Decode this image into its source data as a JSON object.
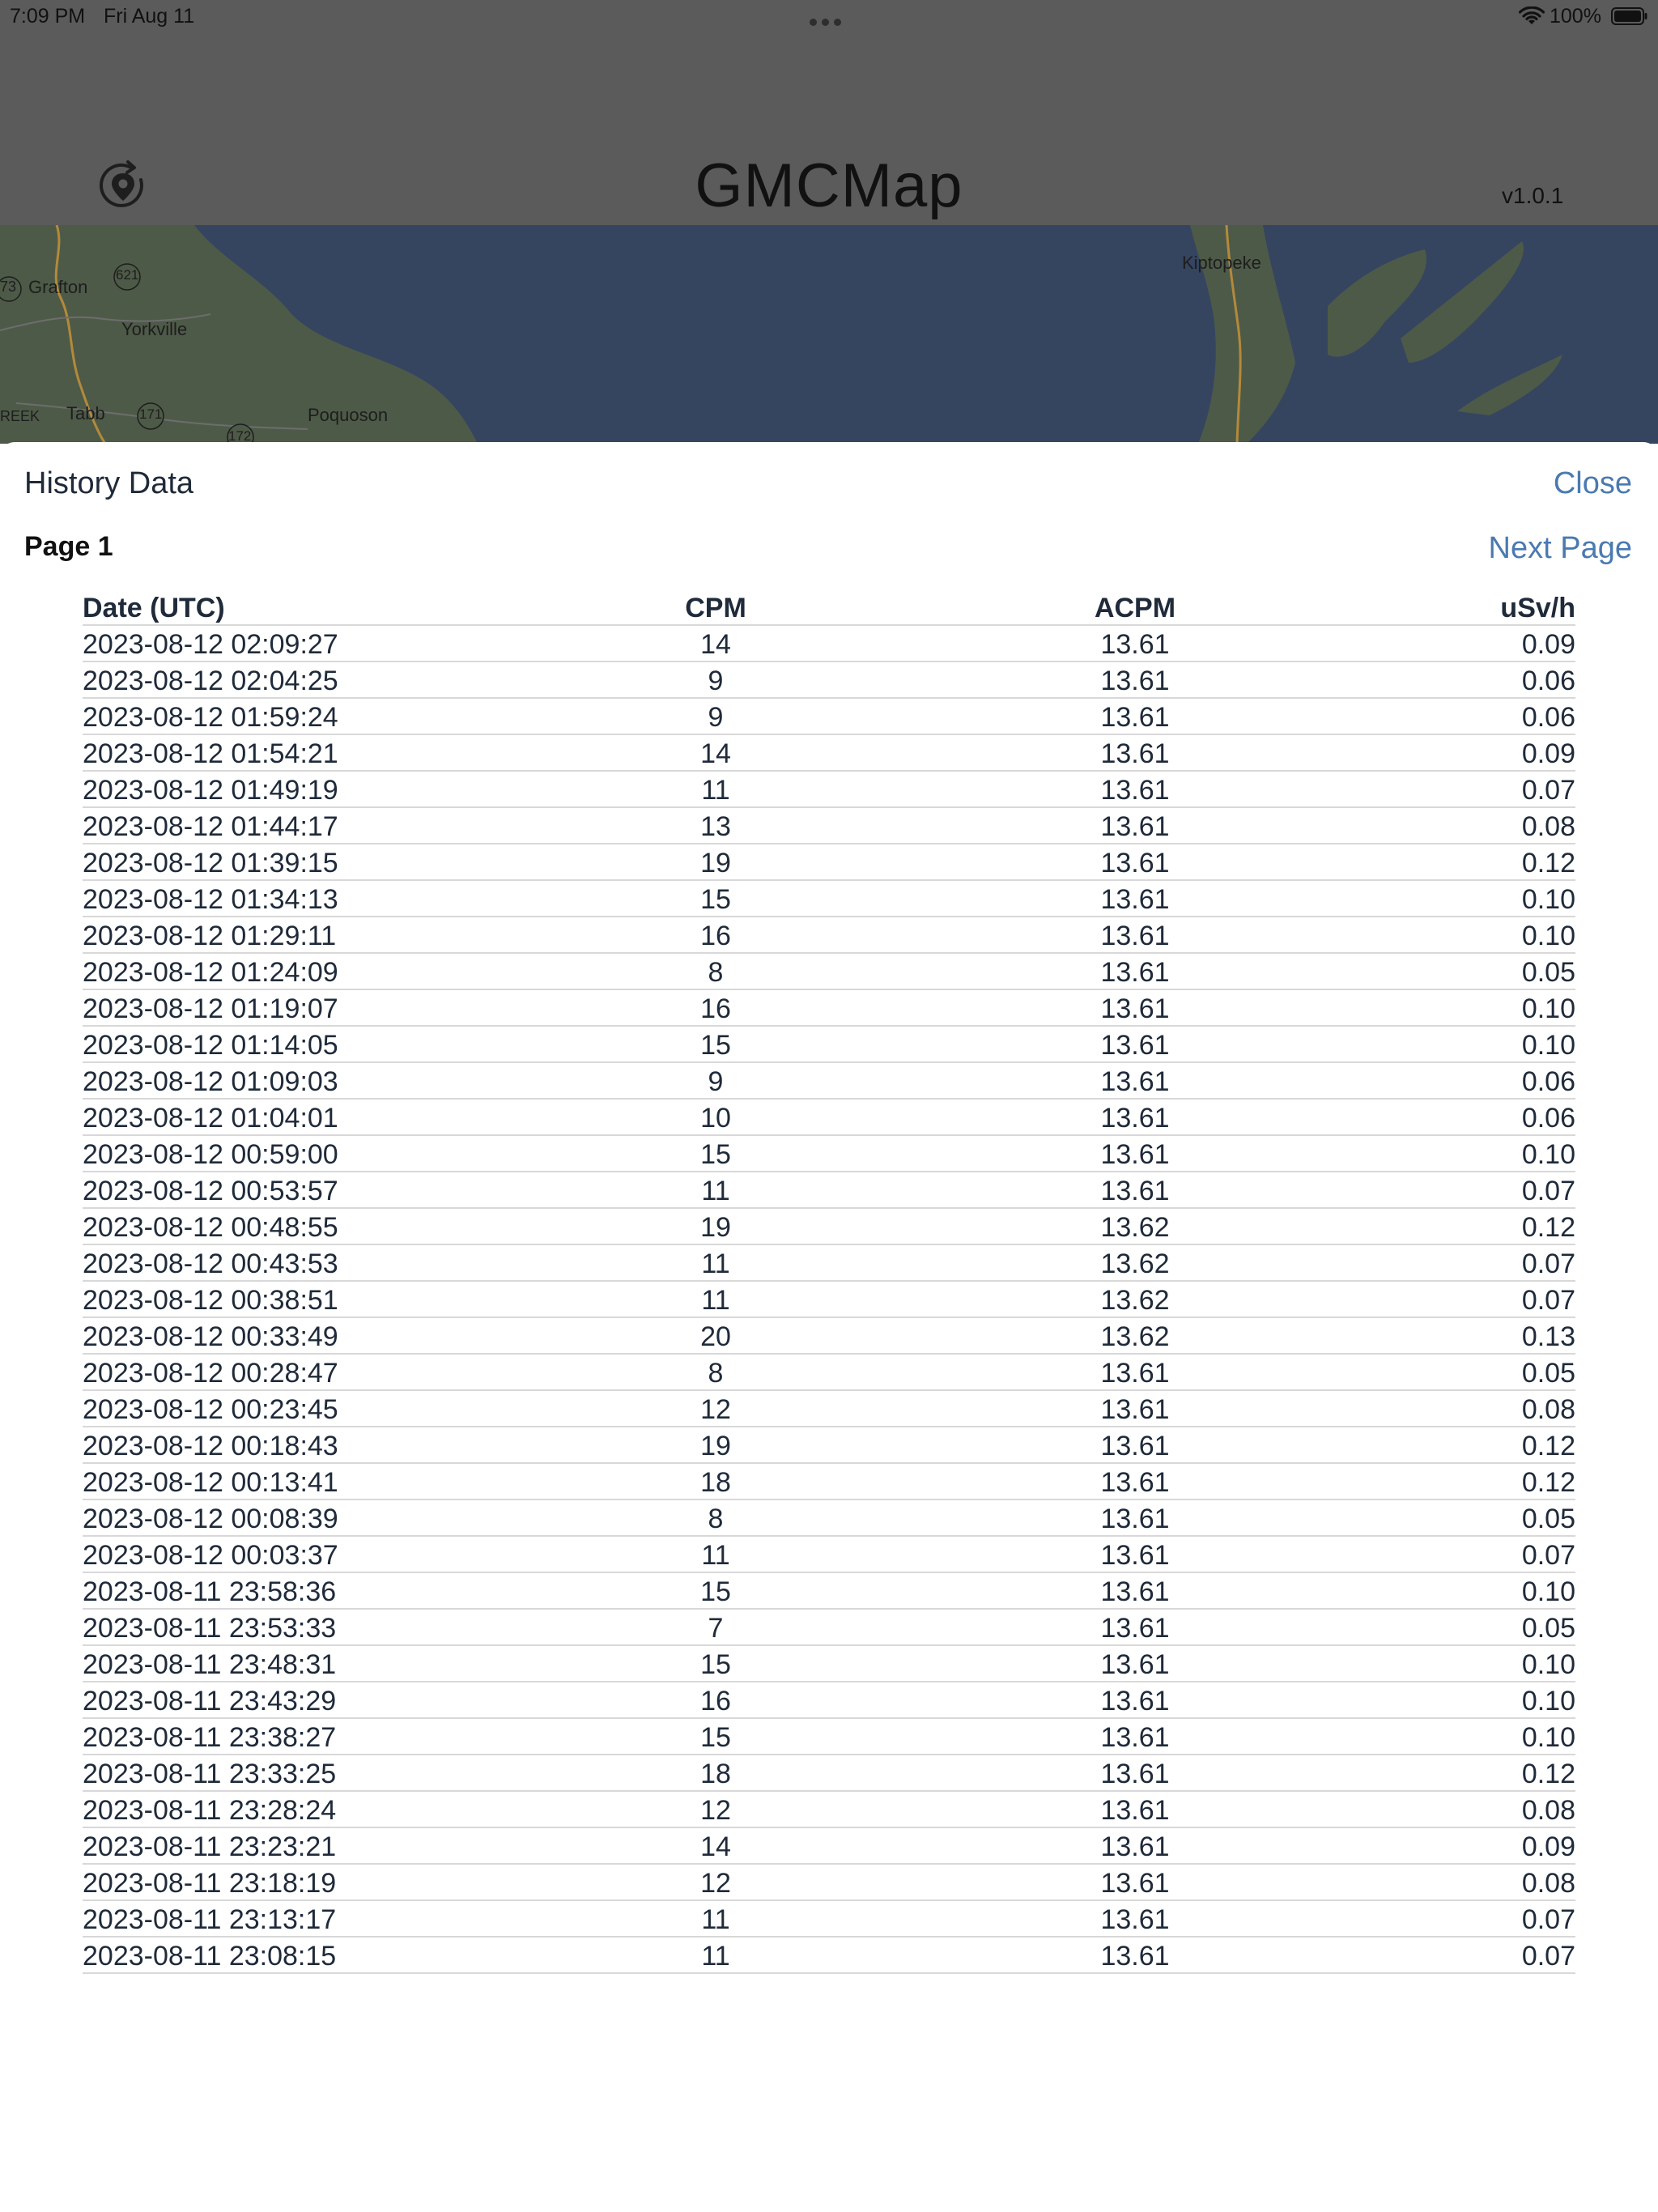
{
  "status_bar": {
    "time": "7:09 PM",
    "date": "Fri Aug 11",
    "battery": "100%"
  },
  "header": {
    "title": "GMCMap",
    "version": "v1.0.1",
    "locate_icon": "locate-refresh-icon"
  },
  "map": {
    "labels": {
      "grafton": "Grafton",
      "yorkville": "Yorkville",
      "tabb": "Tabb",
      "poquoson": "Poquoson",
      "kiptopeke": "Kiptopeke",
      "creek": "REEK",
      "route_73": "73",
      "route_621": "621",
      "route_171": "171",
      "route_172": "172"
    },
    "water_color": "#354560",
    "land_color": "#4e5a48"
  },
  "sheet": {
    "title": "History Data",
    "close_label": "Close",
    "page_label": "Page 1",
    "next_page_label": "Next Page",
    "accent_color": "#4a7ab0"
  },
  "table": {
    "columns": [
      "Date (UTC)",
      "CPM",
      "ACPM",
      "uSv/h"
    ],
    "rows": [
      [
        "2023-08-12 02:09:27",
        "14",
        "13.61",
        "0.09"
      ],
      [
        "2023-08-12 02:04:25",
        "9",
        "13.61",
        "0.06"
      ],
      [
        "2023-08-12 01:59:24",
        "9",
        "13.61",
        "0.06"
      ],
      [
        "2023-08-12 01:54:21",
        "14",
        "13.61",
        "0.09"
      ],
      [
        "2023-08-12 01:49:19",
        "11",
        "13.61",
        "0.07"
      ],
      [
        "2023-08-12 01:44:17",
        "13",
        "13.61",
        "0.08"
      ],
      [
        "2023-08-12 01:39:15",
        "19",
        "13.61",
        "0.12"
      ],
      [
        "2023-08-12 01:34:13",
        "15",
        "13.61",
        "0.10"
      ],
      [
        "2023-08-12 01:29:11",
        "16",
        "13.61",
        "0.10"
      ],
      [
        "2023-08-12 01:24:09",
        "8",
        "13.61",
        "0.05"
      ],
      [
        "2023-08-12 01:19:07",
        "16",
        "13.61",
        "0.10"
      ],
      [
        "2023-08-12 01:14:05",
        "15",
        "13.61",
        "0.10"
      ],
      [
        "2023-08-12 01:09:03",
        "9",
        "13.61",
        "0.06"
      ],
      [
        "2023-08-12 01:04:01",
        "10",
        "13.61",
        "0.06"
      ],
      [
        "2023-08-12 00:59:00",
        "15",
        "13.61",
        "0.10"
      ],
      [
        "2023-08-12 00:53:57",
        "11",
        "13.61",
        "0.07"
      ],
      [
        "2023-08-12 00:48:55",
        "19",
        "13.62",
        "0.12"
      ],
      [
        "2023-08-12 00:43:53",
        "11",
        "13.62",
        "0.07"
      ],
      [
        "2023-08-12 00:38:51",
        "11",
        "13.62",
        "0.07"
      ],
      [
        "2023-08-12 00:33:49",
        "20",
        "13.62",
        "0.13"
      ],
      [
        "2023-08-12 00:28:47",
        "8",
        "13.61",
        "0.05"
      ],
      [
        "2023-08-12 00:23:45",
        "12",
        "13.61",
        "0.08"
      ],
      [
        "2023-08-12 00:18:43",
        "19",
        "13.61",
        "0.12"
      ],
      [
        "2023-08-12 00:13:41",
        "18",
        "13.61",
        "0.12"
      ],
      [
        "2023-08-12 00:08:39",
        "8",
        "13.61",
        "0.05"
      ],
      [
        "2023-08-12 00:03:37",
        "11",
        "13.61",
        "0.07"
      ],
      [
        "2023-08-11 23:58:36",
        "15",
        "13.61",
        "0.10"
      ],
      [
        "2023-08-11 23:53:33",
        "7",
        "13.61",
        "0.05"
      ],
      [
        "2023-08-11 23:48:31",
        "15",
        "13.61",
        "0.10"
      ],
      [
        "2023-08-11 23:43:29",
        "16",
        "13.61",
        "0.10"
      ],
      [
        "2023-08-11 23:38:27",
        "15",
        "13.61",
        "0.10"
      ],
      [
        "2023-08-11 23:33:25",
        "18",
        "13.61",
        "0.12"
      ],
      [
        "2023-08-11 23:28:24",
        "12",
        "13.61",
        "0.08"
      ],
      [
        "2023-08-11 23:23:21",
        "14",
        "13.61",
        "0.09"
      ],
      [
        "2023-08-11 23:18:19",
        "12",
        "13.61",
        "0.08"
      ],
      [
        "2023-08-11 23:13:17",
        "11",
        "13.61",
        "0.07"
      ],
      [
        "2023-08-11 23:08:15",
        "11",
        "13.61",
        "0.07"
      ]
    ]
  }
}
